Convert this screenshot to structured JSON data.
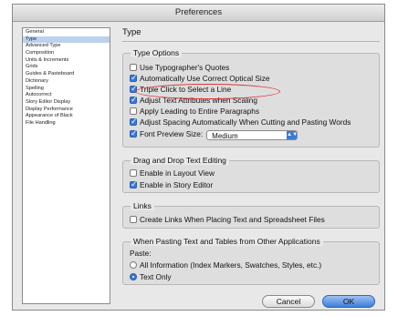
{
  "window": {
    "title": "Preferences"
  },
  "sidebar": {
    "items": [
      {
        "label": "General"
      },
      {
        "label": "Type",
        "selected": true
      },
      {
        "label": "Advanced Type"
      },
      {
        "label": "Composition"
      },
      {
        "label": "Units & Increments"
      },
      {
        "label": "Grids"
      },
      {
        "label": "Guides & Pasteboard"
      },
      {
        "label": "Dictionary"
      },
      {
        "label": "Spelling"
      },
      {
        "label": "Autocorrect"
      },
      {
        "label": "Story Editor Display"
      },
      {
        "label": "Display Performance"
      },
      {
        "label": "Appearance of Black"
      },
      {
        "label": "File Handling"
      }
    ]
  },
  "main": {
    "title": "Type",
    "type_options": {
      "legend": "Type Options",
      "items": [
        {
          "label": "Use Typographer's Quotes",
          "checked": false
        },
        {
          "label": "Automatically Use Correct Optical Size",
          "checked": true
        },
        {
          "label": "Triple Click to Select a Line",
          "checked": true
        },
        {
          "label": "Adjust Text Attributes when Scaling",
          "checked": true
        },
        {
          "label": "Apply Leading to Entire Paragraphs",
          "checked": false
        },
        {
          "label": "Adjust Spacing Automatically When Cutting and Pasting Words",
          "checked": true
        },
        {
          "label": "Font Preview Size:",
          "checked": true
        }
      ],
      "font_preview_value": "Medium"
    },
    "drag_drop": {
      "legend": "Drag and Drop Text Editing",
      "items": [
        {
          "label": "Enable in Layout View",
          "checked": false
        },
        {
          "label": "Enable in Story Editor",
          "checked": true
        }
      ]
    },
    "links": {
      "legend": "Links",
      "items": [
        {
          "label": "Create Links When Placing Text and Spreadsheet Files",
          "checked": false
        }
      ]
    },
    "pasting": {
      "legend": "When Pasting Text and Tables from Other Applications",
      "paste_label": "Paste:",
      "options": [
        {
          "label": "All Information (Index Markers, Swatches, Styles, etc.)",
          "selected": false
        },
        {
          "label": "Text Only",
          "selected": true
        }
      ]
    }
  },
  "buttons": {
    "cancel": "Cancel",
    "ok": "OK"
  },
  "colors": {
    "accent": "#3b78d8",
    "highlight_ring": "#d9393a",
    "selection": "#bcd1ee"
  }
}
